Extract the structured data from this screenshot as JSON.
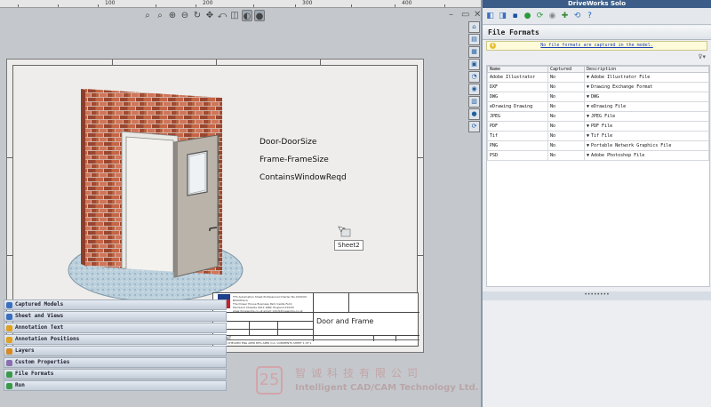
{
  "ruler": {
    "ticks": [
      "100",
      "200",
      "300",
      "400"
    ]
  },
  "drawing": {
    "annotations": [
      "Door-DoorSize",
      "Frame-FrameSize",
      "ContainsWindowReqd"
    ],
    "tooltip": "Sheet2",
    "title_block": {
      "title": "Door and Frame",
      "address_lines": [
        "TTS Automation Sheet Professional Charter No.XXXXXX",
        "Bibliotheca",
        "The Dower House Business Park Castle Farm",
        "Farmland Cheadle SK11 9RW, England XXXXX",
        "www.driveworks.co.uk    email: info@driveworks.co.uk"
      ],
      "scale_label": "WEIGHT",
      "bottom_text": "DRAWN   CHECKED   ENG APPR   MFG APPR   Q.A.   COMMENTS   SHEET 1 OF 1"
    }
  },
  "panel": {
    "title": "DriveWorks Solo",
    "section_title": "File Formats",
    "info_message": "No file formats are captured in the model.",
    "table": {
      "headers": [
        "Name",
        "Captured",
        "Description"
      ],
      "rows": [
        {
          "name": "Adobe Illustrator",
          "captured": "No",
          "description": "Adobe Illustrator File"
        },
        {
          "name": "DXF",
          "captured": "No",
          "description": "Drawing Exchange Format"
        },
        {
          "name": "DWG",
          "captured": "No",
          "description": "DWG"
        },
        {
          "name": "eDrawing Drawing",
          "captured": "No",
          "description": "eDrawing File"
        },
        {
          "name": "JPEG",
          "captured": "No",
          "description": "JPEG File"
        },
        {
          "name": "PDF",
          "captured": "No",
          "description": "PDF File"
        },
        {
          "name": "Tif",
          "captured": "No",
          "description": "Tif File"
        },
        {
          "name": "PNG",
          "captured": "No",
          "description": "Portable Network Graphics File"
        },
        {
          "name": "PSD",
          "captured": "No",
          "description": "Adobe Photoshop File"
        }
      ]
    },
    "accordion": [
      "Captured Models",
      "Sheet and Views",
      "Annotation Text",
      "Annotation Positions",
      "Layers",
      "Custom Properties",
      "File Formats",
      "Run"
    ],
    "accordion_icon_colors": [
      "#3a6fc0",
      "#3a6fc0",
      "#e0a020",
      "#e0a020",
      "#d88a20",
      "#8a6fb0",
      "#3a9a4a",
      "#3a9a4a"
    ]
  },
  "watermark": {
    "logo_text": "25",
    "chinese": "智诚科技有限公司",
    "english": "Intelligent CAD/CAM Technology Ltd."
  }
}
